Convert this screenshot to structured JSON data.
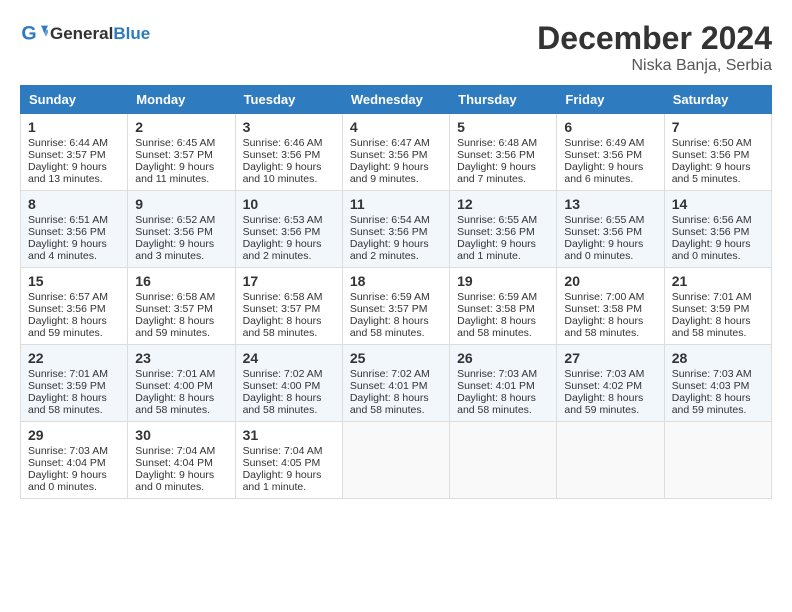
{
  "header": {
    "logo_general": "General",
    "logo_blue": "Blue",
    "title": "December 2024",
    "subtitle": "Niska Banja, Serbia"
  },
  "weekdays": [
    "Sunday",
    "Monday",
    "Tuesday",
    "Wednesday",
    "Thursday",
    "Friday",
    "Saturday"
  ],
  "weeks": [
    [
      {
        "day": "1",
        "lines": [
          "Sunrise: 6:44 AM",
          "Sunset: 3:57 PM",
          "Daylight: 9 hours",
          "and 13 minutes."
        ]
      },
      {
        "day": "2",
        "lines": [
          "Sunrise: 6:45 AM",
          "Sunset: 3:57 PM",
          "Daylight: 9 hours",
          "and 11 minutes."
        ]
      },
      {
        "day": "3",
        "lines": [
          "Sunrise: 6:46 AM",
          "Sunset: 3:56 PM",
          "Daylight: 9 hours",
          "and 10 minutes."
        ]
      },
      {
        "day": "4",
        "lines": [
          "Sunrise: 6:47 AM",
          "Sunset: 3:56 PM",
          "Daylight: 9 hours",
          "and 9 minutes."
        ]
      },
      {
        "day": "5",
        "lines": [
          "Sunrise: 6:48 AM",
          "Sunset: 3:56 PM",
          "Daylight: 9 hours",
          "and 7 minutes."
        ]
      },
      {
        "day": "6",
        "lines": [
          "Sunrise: 6:49 AM",
          "Sunset: 3:56 PM",
          "Daylight: 9 hours",
          "and 6 minutes."
        ]
      },
      {
        "day": "7",
        "lines": [
          "Sunrise: 6:50 AM",
          "Sunset: 3:56 PM",
          "Daylight: 9 hours",
          "and 5 minutes."
        ]
      }
    ],
    [
      {
        "day": "8",
        "lines": [
          "Sunrise: 6:51 AM",
          "Sunset: 3:56 PM",
          "Daylight: 9 hours",
          "and 4 minutes."
        ]
      },
      {
        "day": "9",
        "lines": [
          "Sunrise: 6:52 AM",
          "Sunset: 3:56 PM",
          "Daylight: 9 hours",
          "and 3 minutes."
        ]
      },
      {
        "day": "10",
        "lines": [
          "Sunrise: 6:53 AM",
          "Sunset: 3:56 PM",
          "Daylight: 9 hours",
          "and 2 minutes."
        ]
      },
      {
        "day": "11",
        "lines": [
          "Sunrise: 6:54 AM",
          "Sunset: 3:56 PM",
          "Daylight: 9 hours",
          "and 2 minutes."
        ]
      },
      {
        "day": "12",
        "lines": [
          "Sunrise: 6:55 AM",
          "Sunset: 3:56 PM",
          "Daylight: 9 hours",
          "and 1 minute."
        ]
      },
      {
        "day": "13",
        "lines": [
          "Sunrise: 6:55 AM",
          "Sunset: 3:56 PM",
          "Daylight: 9 hours",
          "and 0 minutes."
        ]
      },
      {
        "day": "14",
        "lines": [
          "Sunrise: 6:56 AM",
          "Sunset: 3:56 PM",
          "Daylight: 9 hours",
          "and 0 minutes."
        ]
      }
    ],
    [
      {
        "day": "15",
        "lines": [
          "Sunrise: 6:57 AM",
          "Sunset: 3:56 PM",
          "Daylight: 8 hours",
          "and 59 minutes."
        ]
      },
      {
        "day": "16",
        "lines": [
          "Sunrise: 6:58 AM",
          "Sunset: 3:57 PM",
          "Daylight: 8 hours",
          "and 59 minutes."
        ]
      },
      {
        "day": "17",
        "lines": [
          "Sunrise: 6:58 AM",
          "Sunset: 3:57 PM",
          "Daylight: 8 hours",
          "and 58 minutes."
        ]
      },
      {
        "day": "18",
        "lines": [
          "Sunrise: 6:59 AM",
          "Sunset: 3:57 PM",
          "Daylight: 8 hours",
          "and 58 minutes."
        ]
      },
      {
        "day": "19",
        "lines": [
          "Sunrise: 6:59 AM",
          "Sunset: 3:58 PM",
          "Daylight: 8 hours",
          "and 58 minutes."
        ]
      },
      {
        "day": "20",
        "lines": [
          "Sunrise: 7:00 AM",
          "Sunset: 3:58 PM",
          "Daylight: 8 hours",
          "and 58 minutes."
        ]
      },
      {
        "day": "21",
        "lines": [
          "Sunrise: 7:01 AM",
          "Sunset: 3:59 PM",
          "Daylight: 8 hours",
          "and 58 minutes."
        ]
      }
    ],
    [
      {
        "day": "22",
        "lines": [
          "Sunrise: 7:01 AM",
          "Sunset: 3:59 PM",
          "Daylight: 8 hours",
          "and 58 minutes."
        ]
      },
      {
        "day": "23",
        "lines": [
          "Sunrise: 7:01 AM",
          "Sunset: 4:00 PM",
          "Daylight: 8 hours",
          "and 58 minutes."
        ]
      },
      {
        "day": "24",
        "lines": [
          "Sunrise: 7:02 AM",
          "Sunset: 4:00 PM",
          "Daylight: 8 hours",
          "and 58 minutes."
        ]
      },
      {
        "day": "25",
        "lines": [
          "Sunrise: 7:02 AM",
          "Sunset: 4:01 PM",
          "Daylight: 8 hours",
          "and 58 minutes."
        ]
      },
      {
        "day": "26",
        "lines": [
          "Sunrise: 7:03 AM",
          "Sunset: 4:01 PM",
          "Daylight: 8 hours",
          "and 58 minutes."
        ]
      },
      {
        "day": "27",
        "lines": [
          "Sunrise: 7:03 AM",
          "Sunset: 4:02 PM",
          "Daylight: 8 hours",
          "and 59 minutes."
        ]
      },
      {
        "day": "28",
        "lines": [
          "Sunrise: 7:03 AM",
          "Sunset: 4:03 PM",
          "Daylight: 8 hours",
          "and 59 minutes."
        ]
      }
    ],
    [
      {
        "day": "29",
        "lines": [
          "Sunrise: 7:03 AM",
          "Sunset: 4:04 PM",
          "Daylight: 9 hours",
          "and 0 minutes."
        ]
      },
      {
        "day": "30",
        "lines": [
          "Sunrise: 7:04 AM",
          "Sunset: 4:04 PM",
          "Daylight: 9 hours",
          "and 0 minutes."
        ]
      },
      {
        "day": "31",
        "lines": [
          "Sunrise: 7:04 AM",
          "Sunset: 4:05 PM",
          "Daylight: 9 hours",
          "and 1 minute."
        ]
      },
      null,
      null,
      null,
      null
    ]
  ]
}
